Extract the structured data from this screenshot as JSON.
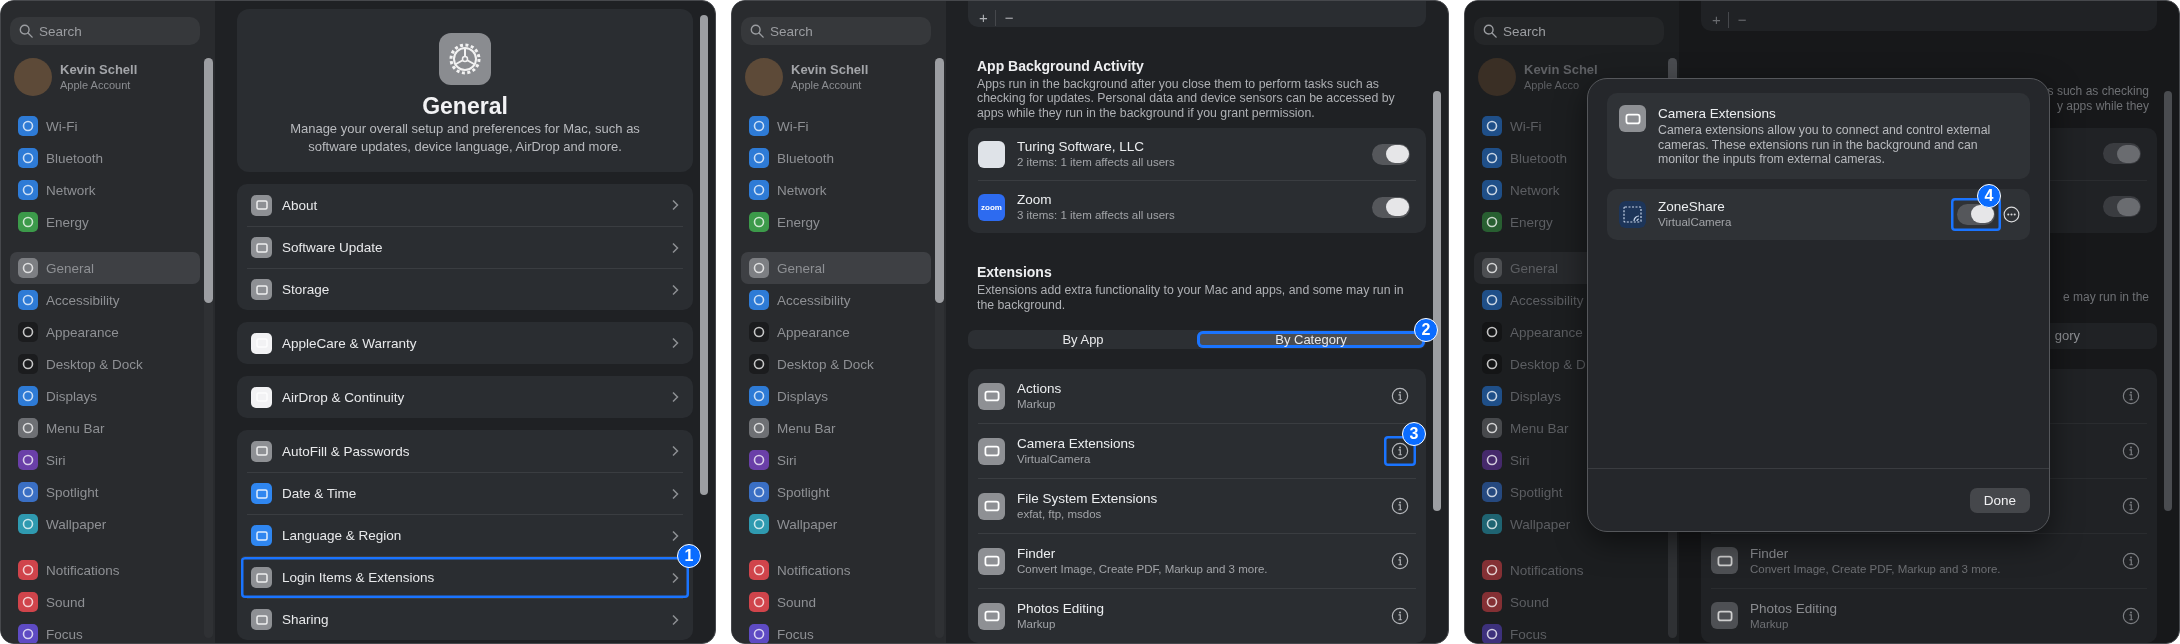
{
  "panels": [
    {
      "kind": "general",
      "sidebar": {
        "search": {
          "placeholder": "Search"
        },
        "account": {
          "name": "Kevin Schell",
          "subtitle": "Apple Account"
        },
        "groups": [
          [
            {
              "label": "Wi-Fi",
              "color": "#2e7bd6",
              "selected": false
            },
            {
              "label": "Bluetooth",
              "color": "#2e7bd6",
              "selected": false
            },
            {
              "label": "Network",
              "color": "#2e7bd6",
              "selected": false
            },
            {
              "label": "Energy",
              "color": "#3c9a4a",
              "selected": false
            }
          ],
          [
            {
              "label": "General",
              "color": "#7d7f83",
              "selected": true
            },
            {
              "label": "Accessibility",
              "color": "#2e7bd6",
              "selected": false
            },
            {
              "label": "Appearance",
              "color": "#1b1c1e",
              "selected": false
            },
            {
              "label": "Desktop & Dock",
              "color": "#1b1c1e",
              "selected": false
            },
            {
              "label": "Displays",
              "color": "#2e7bd6",
              "selected": false
            },
            {
              "label": "Menu Bar",
              "color": "#6e7074",
              "selected": false
            },
            {
              "label": "Siri",
              "color": "#6a3fa8",
              "selected": false
            },
            {
              "label": "Spotlight",
              "color": "#3a6fc4",
              "selected": false
            },
            {
              "label": "Wallpaper",
              "color": "#2f9ab0",
              "selected": false
            }
          ],
          [
            {
              "label": "Notifications",
              "color": "#d0444b",
              "selected": false
            },
            {
              "label": "Sound",
              "color": "#d0444b",
              "selected": false
            },
            {
              "label": "Focus",
              "color": "#5e4bc4",
              "selected": false
            }
          ]
        ]
      },
      "content": {
        "header": {
          "title": "General",
          "description": "Manage your overall setup and preferences for Mac, such as software updates, device language, AirDrop and more."
        },
        "groups": [
          [
            {
              "label": "About",
              "color": "#8e9094"
            },
            {
              "label": "Software Update",
              "color": "#8e9094"
            },
            {
              "label": "Storage",
              "color": "#8e9094"
            }
          ],
          [
            {
              "label": "AppleCare & Warranty",
              "color": "#f2f2f4"
            }
          ],
          [
            {
              "label": "AirDrop & Continuity",
              "color": "#f2f2f4"
            }
          ],
          [
            {
              "label": "AutoFill & Passwords",
              "color": "#8e9094"
            },
            {
              "label": "Date & Time",
              "color": "#2f86f0"
            },
            {
              "label": "Language & Region",
              "color": "#2f86f0"
            },
            {
              "label": "Login Items & Extensions",
              "color": "#8e9094",
              "callout": "1"
            },
            {
              "label": "Sharing",
              "color": "#8e9094"
            }
          ]
        ]
      }
    },
    {
      "kind": "login_items",
      "sidebar": {
        "search": {
          "placeholder": "Search"
        },
        "account": {
          "name": "Kevin Schell",
          "subtitle": "Apple Account"
        },
        "groups": [
          [
            {
              "label": "Wi-Fi",
              "color": "#2e7bd6",
              "selected": false
            },
            {
              "label": "Bluetooth",
              "color": "#2e7bd6",
              "selected": false
            },
            {
              "label": "Network",
              "color": "#2e7bd6",
              "selected": false
            },
            {
              "label": "Energy",
              "color": "#3c9a4a",
              "selected": false
            }
          ],
          [
            {
              "label": "General",
              "color": "#7d7f83",
              "selected": true
            },
            {
              "label": "Accessibility",
              "color": "#2e7bd6",
              "selected": false
            },
            {
              "label": "Appearance",
              "color": "#1b1c1e",
              "selected": false
            },
            {
              "label": "Desktop & Dock",
              "color": "#1b1c1e",
              "selected": false
            },
            {
              "label": "Displays",
              "color": "#2e7bd6",
              "selected": false
            },
            {
              "label": "Menu Bar",
              "color": "#6e7074",
              "selected": false
            },
            {
              "label": "Siri",
              "color": "#6a3fa8",
              "selected": false
            },
            {
              "label": "Spotlight",
              "color": "#3a6fc4",
              "selected": false
            },
            {
              "label": "Wallpaper",
              "color": "#2f9ab0",
              "selected": false
            }
          ],
          [
            {
              "label": "Notifications",
              "color": "#d0444b",
              "selected": false
            },
            {
              "label": "Sound",
              "color": "#d0444b",
              "selected": false
            },
            {
              "label": "Focus",
              "color": "#5e4bc4",
              "selected": false
            }
          ]
        ]
      },
      "content": {
        "toolbar": [
          "+",
          "−"
        ],
        "background_activity": {
          "title": "App Background Activity",
          "description": "Apps run in the background after you close them to perform tasks such as checking for updates. Personal data and device sensors can be accessed by apps while they run in the background if you grant permission.",
          "apps": [
            {
              "name": "Turing Software, LLC",
              "detail": "2 items: 1 item affects all users",
              "color": "#dfe3e8",
              "on": true
            },
            {
              "name": "Zoom",
              "detail": "3 items: 1 item affects all users",
              "color": "#2d6bf0",
              "logo_text": "zoom",
              "on": true
            }
          ]
        },
        "extensions": {
          "title": "Extensions",
          "description": "Extensions add extra functionality to your Mac and apps, and some may run in the background.",
          "segments": [
            {
              "label": "By App",
              "selected": false
            },
            {
              "label": "By Category",
              "selected": true,
              "callout": "2"
            }
          ],
          "items": [
            {
              "title": "Actions",
              "subtitle": "Markup"
            },
            {
              "title": "Camera Extensions",
              "subtitle": "VirtualCamera",
              "callout": "3"
            },
            {
              "title": "File System Extensions",
              "subtitle": "exfat, ftp, msdos"
            },
            {
              "title": "Finder",
              "subtitle": "Convert Image, Create PDF, Markup and 3 more."
            },
            {
              "title": "Photos Editing",
              "subtitle": "Markup"
            }
          ]
        }
      }
    },
    {
      "kind": "extension_dialog",
      "sidebar": {
        "search": {
          "placeholder": "Search"
        },
        "account": {
          "name": "Kevin Schel",
          "subtitle": "Apple Acco"
        },
        "groups": [
          [
            {
              "label": "Wi-Fi",
              "color": "#1f4f88",
              "selected": false
            },
            {
              "label": "Bluetooth",
              "color": "#1f4f88",
              "selected": false
            },
            {
              "label": "Network",
              "color": "#1f4f88",
              "selected": false
            },
            {
              "label": "Energy",
              "color": "#285f31",
              "selected": false
            }
          ],
          [
            {
              "label": "General",
              "color": "#4d4f52",
              "selected": true
            },
            {
              "label": "Accessibility",
              "color": "#1f4f88",
              "selected": false
            },
            {
              "label": "Appearance",
              "color": "#141516",
              "selected": false
            },
            {
              "label": "Desktop & D",
              "color": "#141516",
              "selected": false
            },
            {
              "label": "Displays",
              "color": "#1f4f88",
              "selected": false
            },
            {
              "label": "Menu Bar",
              "color": "#47494c",
              "selected": false
            },
            {
              "label": "Siri",
              "color": "#45296b",
              "selected": false
            },
            {
              "label": "Spotlight",
              "color": "#26497f",
              "selected": false
            },
            {
              "label": "Wallpaper",
              "color": "#1f6472",
              "selected": false
            }
          ],
          [
            {
              "label": "Notifications",
              "color": "#843034",
              "selected": false
            },
            {
              "label": "Sound",
              "color": "#843034",
              "selected": false
            },
            {
              "label": "Focus",
              "color": "#3d317c",
              "selected": false
            }
          ]
        ]
      },
      "content": {
        "toolbar": [
          "+",
          "−"
        ],
        "activity_fragments": [
          "s such as checking",
          "y apps while they"
        ],
        "activity_toggles": [
          {
            "on": true
          },
          {
            "on": true
          }
        ],
        "extensions_fragment": "e may run in the",
        "segment_fragment": "gory",
        "items": [
          {
            "kind": "covered"
          },
          {
            "kind": "covered"
          },
          {
            "kind": "covered"
          },
          {
            "kind": "row",
            "title": "Finder",
            "subtitle": "Convert Image, Create PDF, Markup and 3 more."
          },
          {
            "kind": "row",
            "title": "Photos Editing",
            "subtitle": "Markup"
          }
        ]
      },
      "dialog": {
        "title": "Camera Extensions",
        "description": "Camera extensions allow you to connect and control external cameras. These extensions run in the background and can monitor the inputs from external cameras.",
        "extensions": [
          {
            "name": "ZoneShare",
            "detail": "VirtualCamera",
            "on": true,
            "callout": "4"
          }
        ],
        "done": "Done"
      }
    }
  ]
}
